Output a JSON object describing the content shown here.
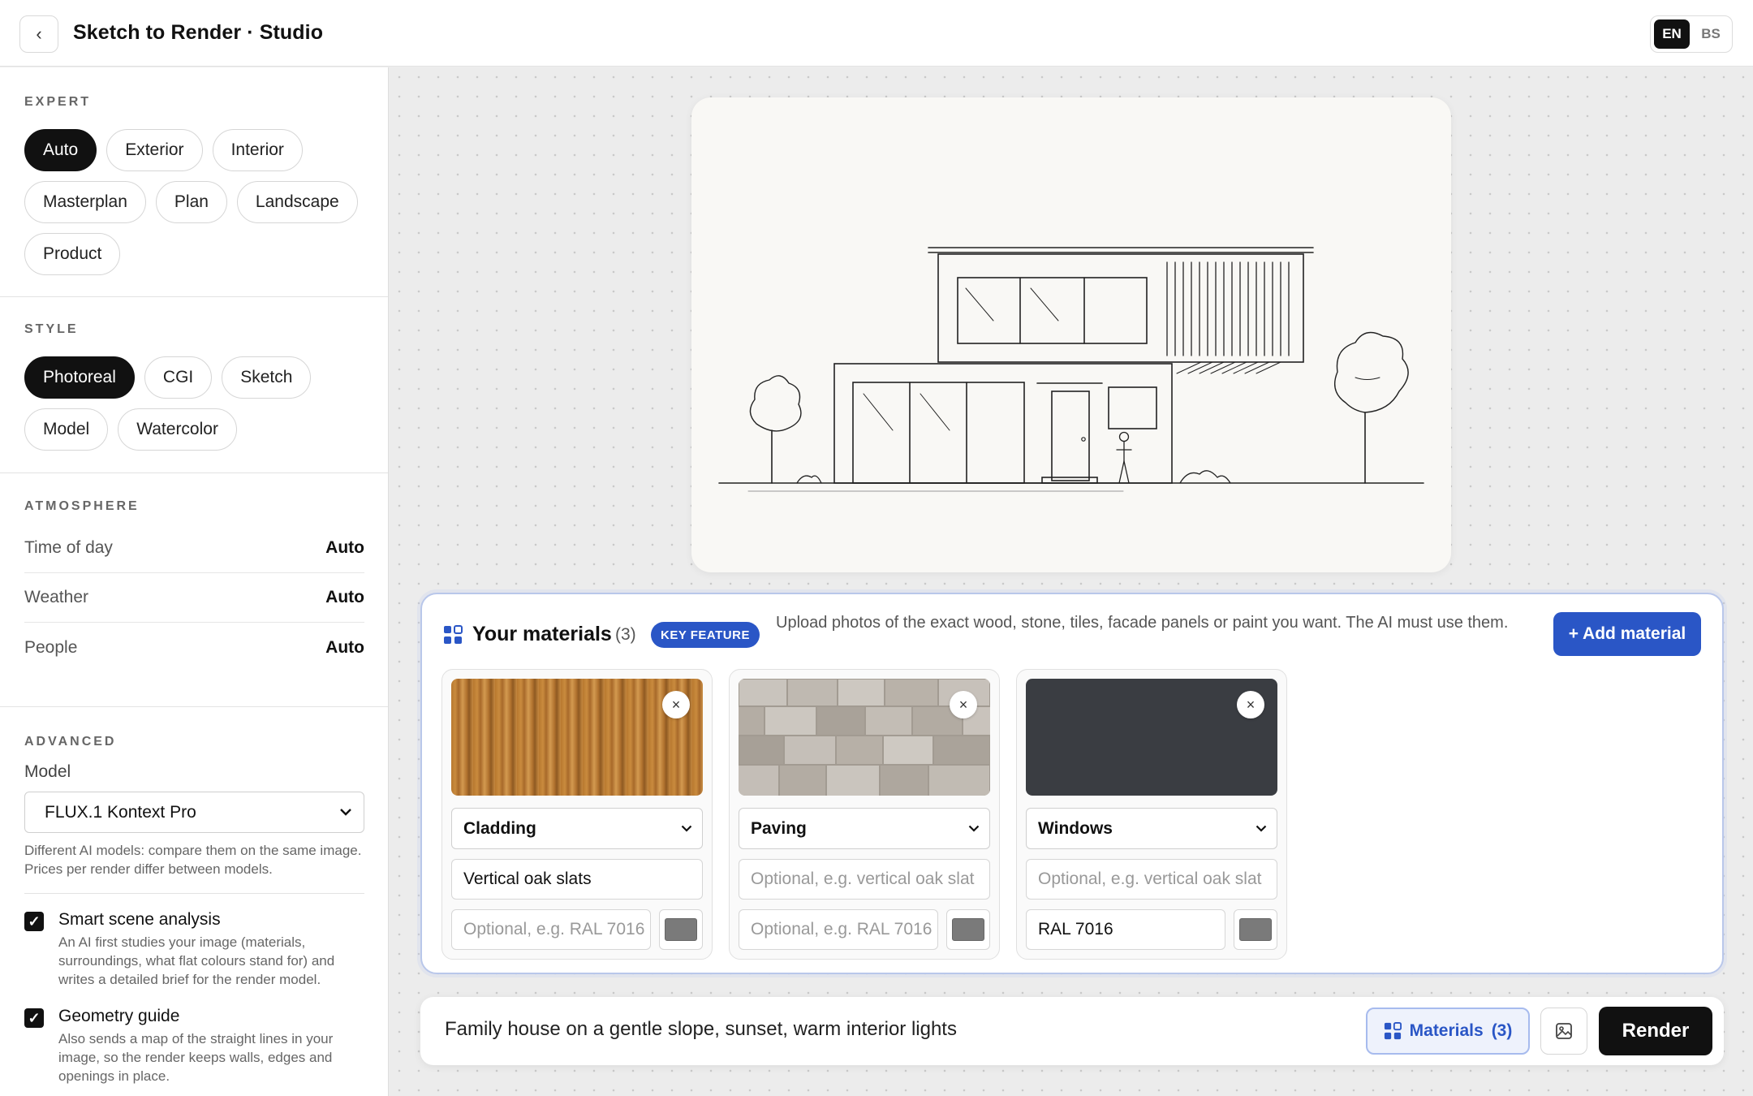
{
  "header": {
    "back_glyph": "‹",
    "title": "Sketch to Render · Studio",
    "languages": [
      "EN",
      "BS"
    ],
    "active_language": "EN"
  },
  "sidebar": {
    "expert": {
      "title": "EXPERT",
      "options": [
        "Auto",
        "Exterior",
        "Interior",
        "Masterplan",
        "Plan",
        "Landscape",
        "Product"
      ],
      "selected": "Auto"
    },
    "style": {
      "title": "STYLE",
      "options": [
        "Photoreal",
        "CGI",
        "Sketch",
        "Model",
        "Watercolor"
      ],
      "selected": "Photoreal"
    },
    "atmosphere": {
      "title": "ATMOSPHERE",
      "rows": [
        {
          "label": "Time of day",
          "value": "Auto"
        },
        {
          "label": "Weather",
          "value": "Auto"
        },
        {
          "label": "People",
          "value": "Auto"
        }
      ]
    },
    "advanced": {
      "title": "ADVANCED",
      "model_label": "Model",
      "model_value": "FLUX.1 Kontext Pro",
      "model_hint": "Different AI models: compare them on the same image. Prices per render differ between models.",
      "options": [
        {
          "title": "Smart scene analysis",
          "checked": true,
          "desc": "An AI first studies your image (materials, surroundings, what flat colours stand for) and writes a detailed brief for the render model."
        },
        {
          "title": "Geometry guide",
          "checked": true,
          "desc": "Also sends a map of the straight lines in your image, so the render keeps walls, edges and openings in place."
        }
      ]
    }
  },
  "materials": {
    "title": "Your materials",
    "count": "(3)",
    "badge": "KEY FEATURE",
    "description": "Upload photos of the exact wood, stone, tiles, facade panels or paint you want. The AI must use them.",
    "add_button": "+ Add material",
    "items": [
      {
        "texture": "wood",
        "category": "Cladding",
        "name": "Vertical oak slats",
        "name_placeholder": "Optional, e.g. vertical oak slat",
        "color": "",
        "color_placeholder": "Optional, e.g. RAL 7016"
      },
      {
        "texture": "stone",
        "category": "Paving",
        "name": "",
        "name_placeholder": "Optional, e.g. vertical oak slat",
        "color": "",
        "color_placeholder": "Optional, e.g. RAL 7016"
      },
      {
        "texture": "dark",
        "category": "Windows",
        "name": "",
        "name_placeholder": "Optional, e.g. vertical oak slat",
        "color": "RAL 7016",
        "color_placeholder": "Optional, e.g. RAL 7016"
      }
    ]
  },
  "prompt": {
    "text": "Family house on a gentle slope, sunset, warm interior lights",
    "materials_button": "Materials",
    "materials_count": "(3)",
    "render_button": "Render"
  },
  "colors": {
    "accent": "#2a56c6",
    "dark": "#111111",
    "swatch_dark": "#3a3d42"
  }
}
